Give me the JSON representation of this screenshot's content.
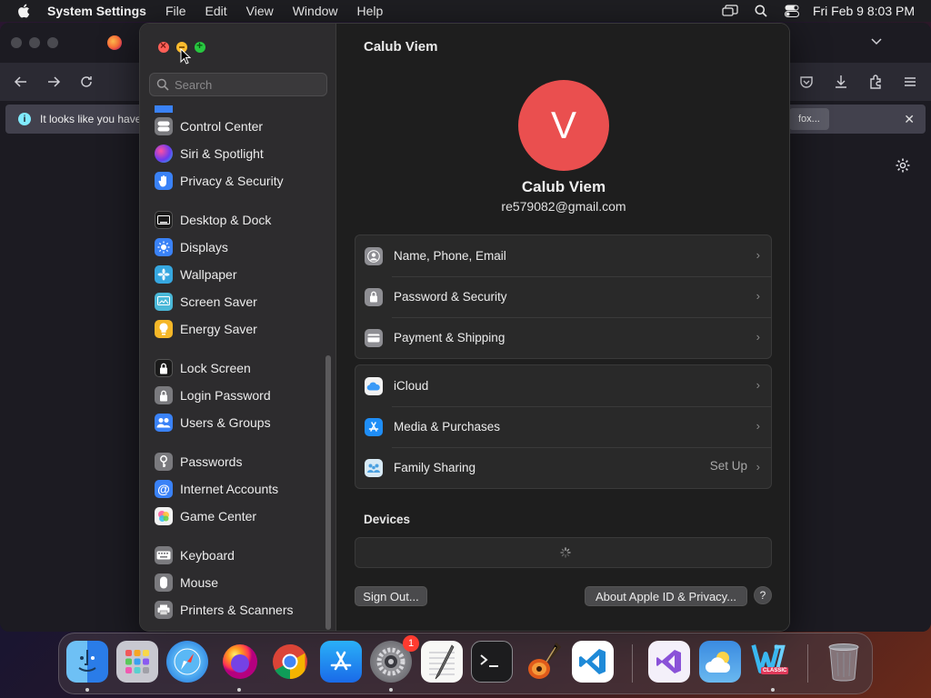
{
  "menubar": {
    "app_name": "System Settings",
    "items": [
      "File",
      "Edit",
      "View",
      "Window",
      "Help"
    ],
    "clock": "Fri Feb 9  8:03 PM"
  },
  "browser": {
    "info_text": "It looks like you have",
    "info_button": "fox..."
  },
  "search": {
    "placeholder": "Search"
  },
  "sidebar": {
    "items": [
      {
        "label": "Control Center",
        "icon": "control-center-icon",
        "color": "#7a7a7e"
      },
      {
        "label": "Siri & Spotlight",
        "icon": "siri-icon",
        "color": "#b03ab5"
      },
      {
        "label": "Privacy & Security",
        "icon": "hand-icon",
        "color": "#3a82f7"
      },
      {
        "label": "Desktop & Dock",
        "icon": "dock-icon",
        "color": "#1a1a1a"
      },
      {
        "label": "Displays",
        "icon": "sun-icon",
        "color": "#3a82f7"
      },
      {
        "label": "Wallpaper",
        "icon": "flower-icon",
        "color": "#36a7e0"
      },
      {
        "label": "Screen Saver",
        "icon": "screen-saver-icon",
        "color": "#4ab8d8"
      },
      {
        "label": "Energy Saver",
        "icon": "bulb-icon",
        "color": "#f5b728"
      },
      {
        "label": "Lock Screen",
        "icon": "lock-screen-icon",
        "color": "#1a1a1a"
      },
      {
        "label": "Login Password",
        "icon": "lock-icon",
        "color": "#7a7a7e"
      },
      {
        "label": "Users & Groups",
        "icon": "users-icon",
        "color": "#3a82f7"
      },
      {
        "label": "Passwords",
        "icon": "key-icon",
        "color": "#7a7a7e"
      },
      {
        "label": "Internet Accounts",
        "icon": "at-icon",
        "color": "#3a82f7"
      },
      {
        "label": "Game Center",
        "icon": "game-center-icon",
        "color": "#f2f2f2"
      },
      {
        "label": "Keyboard",
        "icon": "keyboard-icon",
        "color": "#7a7a7e"
      },
      {
        "label": "Mouse",
        "icon": "mouse-icon",
        "color": "#7a7a7e"
      },
      {
        "label": "Printers & Scanners",
        "icon": "printer-icon",
        "color": "#7a7a7e"
      }
    ]
  },
  "main": {
    "title": "Calub Viem",
    "avatar_letter": "V",
    "avatar_color": "#ea4f4f",
    "user_name": "Calub Viem",
    "user_email": "re579082@gmail.com",
    "group1": [
      {
        "label": "Name, Phone, Email",
        "icon": "person-icon"
      },
      {
        "label": "Password & Security",
        "icon": "lock-icon"
      },
      {
        "label": "Payment & Shipping",
        "icon": "card-icon"
      }
    ],
    "group2": [
      {
        "label": "iCloud",
        "icon": "icloud-icon"
      },
      {
        "label": "Media & Purchases",
        "icon": "app-store-icon"
      },
      {
        "label": "Family Sharing",
        "icon": "family-icon",
        "value": "Set Up"
      }
    ],
    "devices_title": "Devices",
    "sign_out": "Sign Out...",
    "about": "About Apple ID & Privacy...",
    "help": "?"
  },
  "dock": {
    "items": [
      "Finder",
      "Launchpad",
      "Safari",
      "Firefox",
      "Chrome",
      "App Store",
      "System Settings",
      "TextEdit",
      "Terminal",
      "GarageBand",
      "Visual Studio Code",
      "Visual Studio",
      "Weather",
      "Windows",
      "Trash"
    ],
    "badge": "1",
    "windows_label": "CLASSIC"
  }
}
